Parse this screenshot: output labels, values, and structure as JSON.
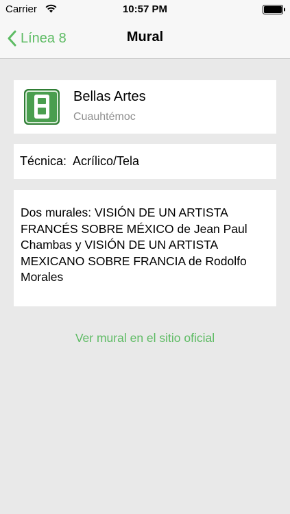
{
  "status_bar": {
    "carrier": "Carrier",
    "time": "10:57 PM"
  },
  "nav": {
    "back_label": "Línea 8",
    "title": "Mural"
  },
  "station": {
    "line_number": "8",
    "name": "Bellas Artes",
    "borough": "Cuauhtémoc"
  },
  "technique": {
    "label": "Técnica:",
    "value": "Acrílico/Tela"
  },
  "description": "Dos murales: VISIÓN DE UN ARTISTA FRANCÉS SOBRE MÉXICO de Jean Paul Chambas y VISIÓN DE UN ARTISTA MEXICANO SOBRE FRANCIA de Rodolfo Morales",
  "official_link": "Ver mural en el sitio oficial",
  "colors": {
    "accent": "#5dbb63",
    "line_8": "#3a8c3f",
    "background": "#e9e9e9"
  }
}
